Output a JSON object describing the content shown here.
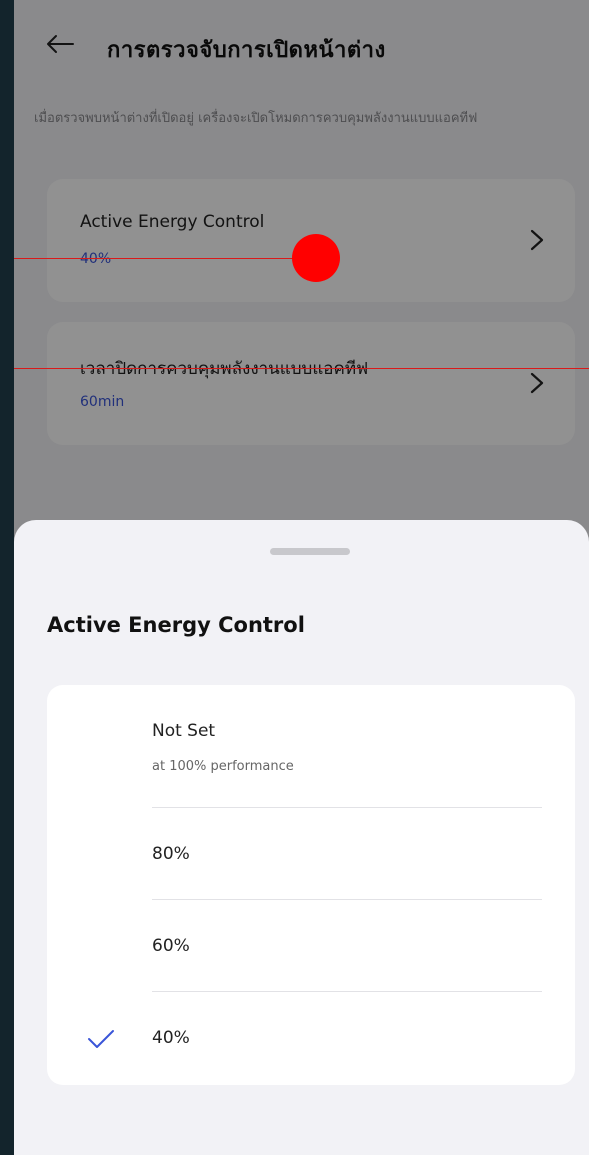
{
  "header": {
    "title": "การตรวจจับการเปิดหน้าต่าง"
  },
  "description": "เมื่อตรวจพบหน้าต่างที่เปิดอยู่ เครื่องจะเปิดโหมดการควบคุมพลังงานแบบแอคทีฟ",
  "settings": [
    {
      "label": "Active Energy Control",
      "value": "40%"
    },
    {
      "label": "เวลาปิดการควบคุมพลังงานแบบแอคทีฟ",
      "value": "60min"
    }
  ],
  "sheet": {
    "title": "Active Energy Control",
    "options": [
      {
        "label": "Not Set",
        "sublabel": "at 100% performance",
        "selected": false
      },
      {
        "label": "80%",
        "selected": false
      },
      {
        "label": "60%",
        "selected": false
      },
      {
        "label": "40%",
        "selected": true
      }
    ]
  },
  "colors": {
    "accent": "#3a55d8",
    "touch_indicator": "#ff0000"
  }
}
